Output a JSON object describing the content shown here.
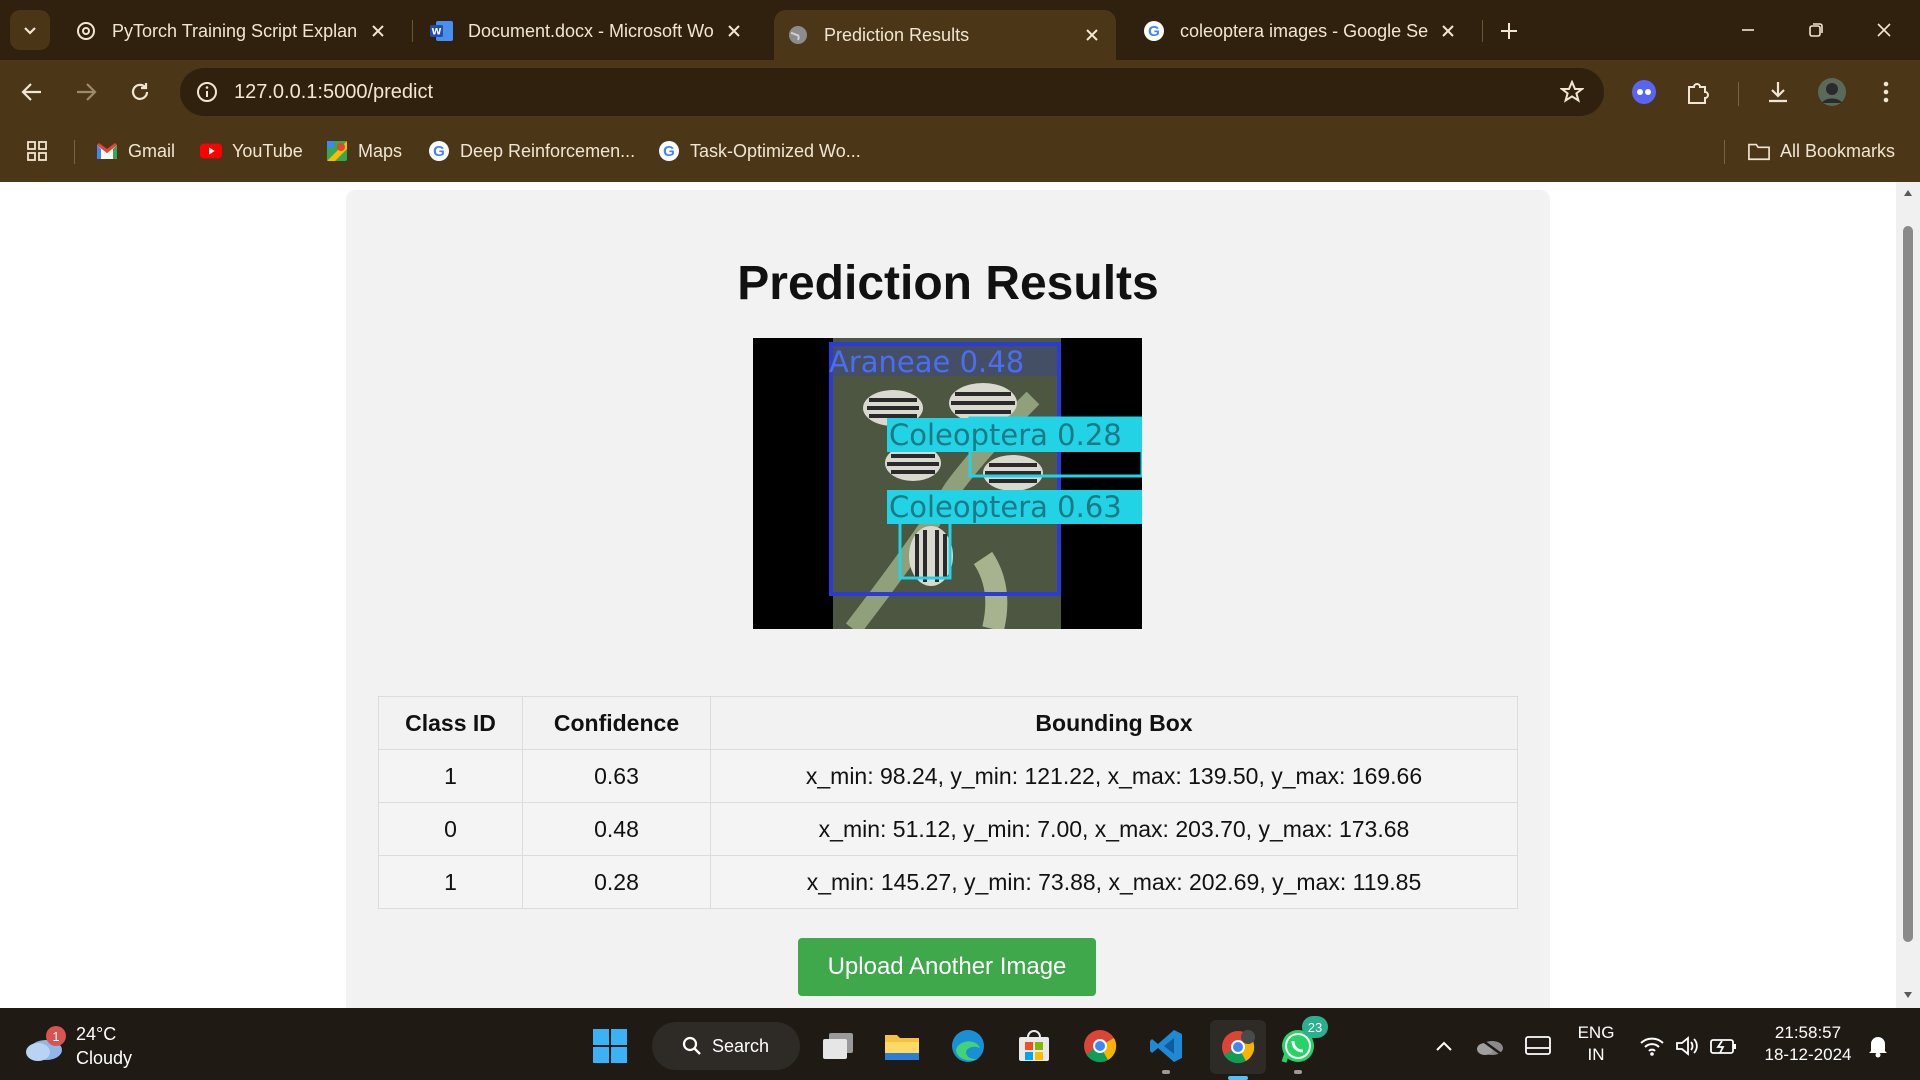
{
  "browser": {
    "tabs": [
      {
        "title": "PyTorch Training Script Explanat",
        "favicon": "openai-icon",
        "active": false
      },
      {
        "title": "Document.docx - Microsoft Wo",
        "favicon": "word-icon",
        "active": false
      },
      {
        "title": "Prediction Results",
        "favicon": "globe-icon",
        "active": true
      },
      {
        "title": "coleoptera images - Google Sea",
        "favicon": "google-icon",
        "active": false
      }
    ],
    "url": "127.0.0.1:5000/predict",
    "bookmarks": [
      {
        "label": "Gmail",
        "icon": "gmail-icon"
      },
      {
        "label": "YouTube",
        "icon": "youtube-icon"
      },
      {
        "label": "Maps",
        "icon": "maps-icon"
      },
      {
        "label": "Deep Reinforcemen...",
        "icon": "google-icon"
      },
      {
        "label": "Task-Optimized Wo...",
        "icon": "google-icon"
      }
    ],
    "all_bookmarks_label": "All Bookmarks"
  },
  "page": {
    "title": "Prediction Results",
    "image": {
      "labels": [
        {
          "text": "Araneae 0.48",
          "color": "#2b3bd6"
        },
        {
          "text": "Coleoptera 0.28",
          "color": "#22d3e6"
        },
        {
          "text": "Coleoptera 0.63",
          "color": "#22d3e6"
        }
      ]
    },
    "table": {
      "headers": [
        "Class ID",
        "Confidence",
        "Bounding Box"
      ],
      "rows": [
        {
          "class_id": "1",
          "confidence": "0.63",
          "bbox": "x_min: 98.24, y_min: 121.22, x_max: 139.50, y_max: 169.66"
        },
        {
          "class_id": "0",
          "confidence": "0.48",
          "bbox": "x_min: 51.12, y_min: 7.00, x_max: 203.70, y_max: 173.68"
        },
        {
          "class_id": "1",
          "confidence": "0.28",
          "bbox": "x_min: 145.27, y_min: 73.88, x_max: 202.69, y_max: 119.85"
        }
      ]
    },
    "upload_button": "Upload Another Image",
    "button_color": "#3ea84a"
  },
  "taskbar": {
    "weather": {
      "temp": "24°C",
      "condition": "Cloudy",
      "badge": "1"
    },
    "search_label": "Search",
    "whatsapp_badge": "23",
    "lang": {
      "line1": "ENG",
      "line2": "IN"
    },
    "time": "21:58:57",
    "date": "18-12-2024"
  }
}
